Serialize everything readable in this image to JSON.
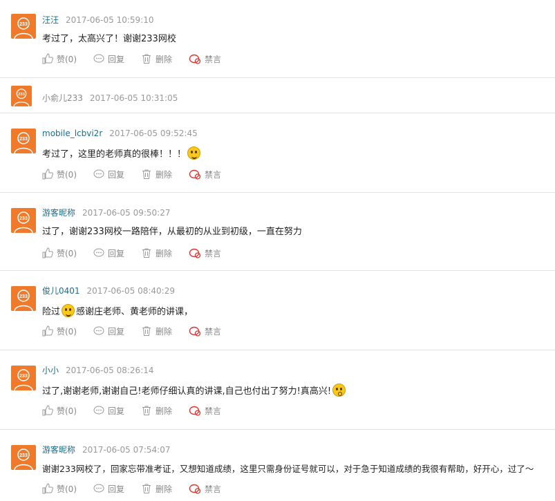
{
  "actions": {
    "like": "赞(0)",
    "reply": "回复",
    "delete": "删除",
    "ban": "禁言"
  },
  "avatar_text": "233",
  "comments": [
    {
      "user": "汪汪",
      "time": "2017-06-05 10:59:10",
      "text": "考过了，太高兴了！谢谢233网校"
    },
    {
      "user": "小俞儿233",
      "time": "2017-06-05 10:31:05",
      "text": ""
    },
    {
      "user": "mobile_lcbvi2r",
      "time": "2017-06-05 09:52:45",
      "text": "考过了，这里的老师真的很棒！！！"
    },
    {
      "user": "游客昵称",
      "time": "2017-06-05 09:50:27",
      "text": "过了，谢谢233网校一路陪伴，从最初的从业到初级，一直在努力"
    },
    {
      "user": "俊儿0401",
      "time": "2017-06-05 08:40:29",
      "text_before": "险过",
      "text_after": "感谢庄老师、黄老师的讲课，"
    },
    {
      "user": "小小",
      "time": "2017-06-05 08:26:14",
      "text": "过了,谢谢老师,谢谢自己!老师仔细认真的讲课,自己也付出了努力!真高兴!"
    },
    {
      "user": "游客昵称",
      "time": "2017-06-05 07:54:07",
      "text": "谢谢233网校了，回家忘带准考证，又想知道成绩，这里只需身份证号就可以，对于急于知道成绩的我很有帮助，好开心，过了～"
    }
  ]
}
